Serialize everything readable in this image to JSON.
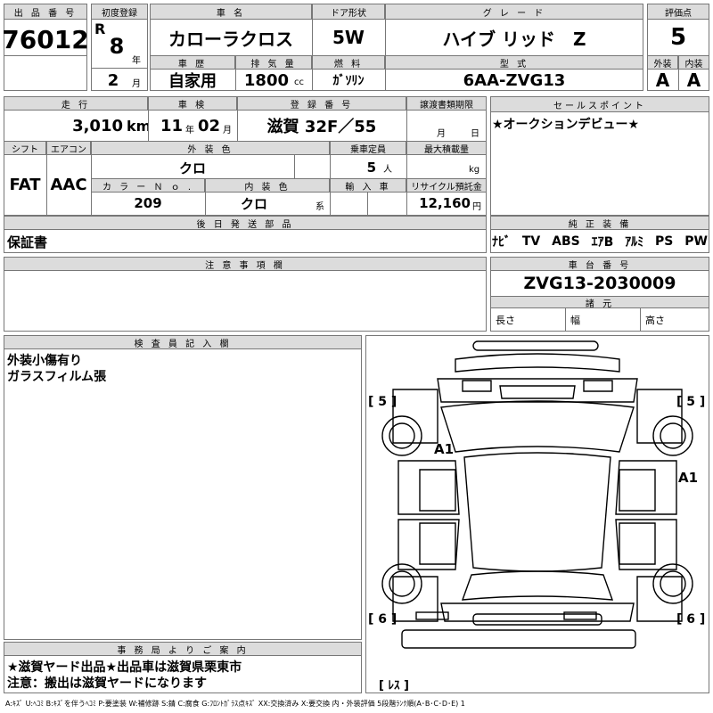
{
  "header": {
    "lot_label": "出 品 番 号",
    "lot_number": "76012",
    "reg_label": "初度登録",
    "era": "R",
    "reg_year": "8",
    "year_unit": "年",
    "reg_month": "2",
    "month_unit": "月",
    "car_name_label": "車 名",
    "car_name": "カローラクロス",
    "door_label": "ドア形状",
    "door": "5W",
    "grade_label": "グ レ ー ド",
    "grade": "ハイブ リッド　Z",
    "score_label": "評価点",
    "score": "5",
    "history_label": "車 歴",
    "history": "自家用",
    "displacement_label": "排 気 量",
    "displacement": "1800",
    "cc_unit": "cc",
    "fuel_label": "燃 料",
    "fuel": "ｶﾞｿﾘﾝ",
    "model_label": "型 式",
    "model": "6AA-ZVG13",
    "exterior_label": "外装",
    "exterior_grade": "A",
    "interior_label": "内装",
    "interior_grade": "A"
  },
  "row2": {
    "mileage_label": "走 行",
    "mileage": "3,010",
    "km_unit": "km",
    "inspection_label": "車 検",
    "insp_year": "11",
    "insp_year_unit": "年",
    "insp_month": "02",
    "insp_month_unit": "月",
    "plate_label": "登 録 番 号",
    "plate": "滋賀 32F／55",
    "transfer_label": "譲渡書類期限",
    "transfer_month_unit": "月",
    "transfer_day_unit": "日",
    "shift_label": "シフト",
    "shift": "FAT",
    "ac_label": "エアコン",
    "ac": "AAC",
    "ext_color_label": "外 装 色",
    "ext_color": "クロ",
    "capacity_label": "乗車定員",
    "capacity": "5",
    "capacity_unit": "人",
    "max_load_label": "最大積載量",
    "max_load_unit": "kg",
    "color_no_label": "カ ラ ー Ｎ ｏ .",
    "color_no": "209",
    "int_color_label": "内 装 色",
    "int_color": "クロ",
    "int_color_unit": "系",
    "import_label": "輸 入 車",
    "recycle_label": "リサイクル預託金",
    "recycle": "12,160",
    "recycle_unit": "円"
  },
  "sales_point": {
    "label": "セールスポイント",
    "text": "★オークションデビュー★"
  },
  "later_parts": {
    "label": "後 日 発 送 部 品",
    "text": "保証書"
  },
  "equipment": {
    "label": "純 正 装 備",
    "items": [
      "ﾅﾋﾞ",
      "TV",
      "ABS",
      "ｴｱB",
      "ｱﾙﾐ",
      "PS",
      "PW"
    ]
  },
  "notes": {
    "label": "注 意 事 項 欄"
  },
  "chassis": {
    "label": "車 台 番 号",
    "number": "ZVG13-2030009",
    "specs_label": "諸 元",
    "length_label": "長さ",
    "width_label": "幅",
    "height_label": "高さ"
  },
  "inspector": {
    "label": "検 査 員 記 入 欄",
    "line1": "外装小傷有り",
    "line2": "ガラスフィルム張"
  },
  "office": {
    "label": "事 務 局 よ り ご 案 内",
    "line1": "★滋賀ヤード出品★出品車は滋賀県栗東市",
    "line2": "注意：搬出は滋賀ヤードになります"
  },
  "diagram": {
    "tire_front_left": "[ 5 ]",
    "tire_front_right": "[ 5 ]",
    "tire_rear_left": "[ 6 ]",
    "tire_rear_right": "[ 6 ]",
    "spare": "[ ﾚｽ ]",
    "mark_left": "A1",
    "mark_right": "A1"
  },
  "legend": "A:ｷｽﾞ  U:ﾍｺﾐ  B:ｷｽﾞを伴うﾍｺﾐ  P:要塗装  W:補修跡  S:錆  C:腐食  G:ﾌﾛﾝﾄｶﾞﾗｽ点ｷｽﾞ  XX:交換済み  X:要交換   内・外装評価  5段階ﾗﾝｸ順(A･B･C･D･E) 1"
}
